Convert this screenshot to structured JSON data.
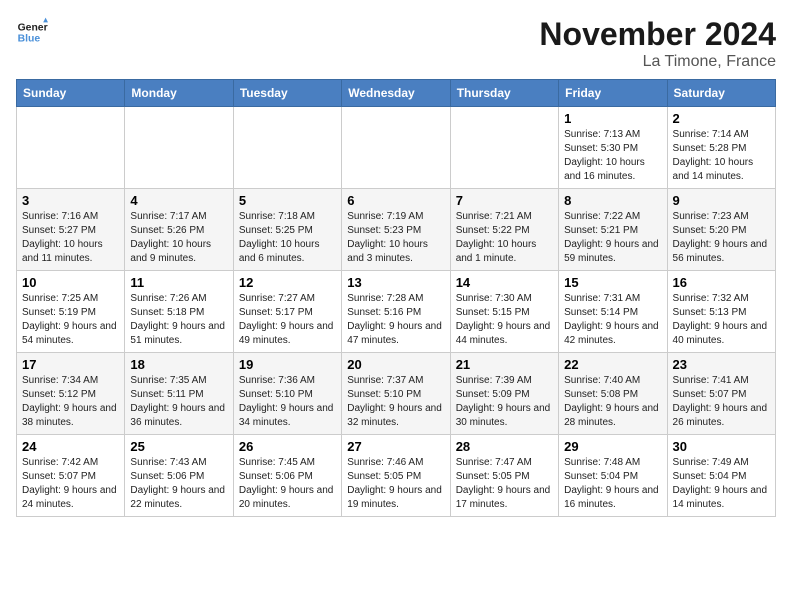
{
  "logo": {
    "line1": "General",
    "line2": "Blue"
  },
  "title": "November 2024",
  "location": "La Timone, France",
  "weekdays": [
    "Sunday",
    "Monday",
    "Tuesday",
    "Wednesday",
    "Thursday",
    "Friday",
    "Saturday"
  ],
  "weeks": [
    [
      {
        "day": "",
        "info": ""
      },
      {
        "day": "",
        "info": ""
      },
      {
        "day": "",
        "info": ""
      },
      {
        "day": "",
        "info": ""
      },
      {
        "day": "",
        "info": ""
      },
      {
        "day": "1",
        "info": "Sunrise: 7:13 AM\nSunset: 5:30 PM\nDaylight: 10 hours and 16 minutes."
      },
      {
        "day": "2",
        "info": "Sunrise: 7:14 AM\nSunset: 5:28 PM\nDaylight: 10 hours and 14 minutes."
      }
    ],
    [
      {
        "day": "3",
        "info": "Sunrise: 7:16 AM\nSunset: 5:27 PM\nDaylight: 10 hours and 11 minutes."
      },
      {
        "day": "4",
        "info": "Sunrise: 7:17 AM\nSunset: 5:26 PM\nDaylight: 10 hours and 9 minutes."
      },
      {
        "day": "5",
        "info": "Sunrise: 7:18 AM\nSunset: 5:25 PM\nDaylight: 10 hours and 6 minutes."
      },
      {
        "day": "6",
        "info": "Sunrise: 7:19 AM\nSunset: 5:23 PM\nDaylight: 10 hours and 3 minutes."
      },
      {
        "day": "7",
        "info": "Sunrise: 7:21 AM\nSunset: 5:22 PM\nDaylight: 10 hours and 1 minute."
      },
      {
        "day": "8",
        "info": "Sunrise: 7:22 AM\nSunset: 5:21 PM\nDaylight: 9 hours and 59 minutes."
      },
      {
        "day": "9",
        "info": "Sunrise: 7:23 AM\nSunset: 5:20 PM\nDaylight: 9 hours and 56 minutes."
      }
    ],
    [
      {
        "day": "10",
        "info": "Sunrise: 7:25 AM\nSunset: 5:19 PM\nDaylight: 9 hours and 54 minutes."
      },
      {
        "day": "11",
        "info": "Sunrise: 7:26 AM\nSunset: 5:18 PM\nDaylight: 9 hours and 51 minutes."
      },
      {
        "day": "12",
        "info": "Sunrise: 7:27 AM\nSunset: 5:17 PM\nDaylight: 9 hours and 49 minutes."
      },
      {
        "day": "13",
        "info": "Sunrise: 7:28 AM\nSunset: 5:16 PM\nDaylight: 9 hours and 47 minutes."
      },
      {
        "day": "14",
        "info": "Sunrise: 7:30 AM\nSunset: 5:15 PM\nDaylight: 9 hours and 44 minutes."
      },
      {
        "day": "15",
        "info": "Sunrise: 7:31 AM\nSunset: 5:14 PM\nDaylight: 9 hours and 42 minutes."
      },
      {
        "day": "16",
        "info": "Sunrise: 7:32 AM\nSunset: 5:13 PM\nDaylight: 9 hours and 40 minutes."
      }
    ],
    [
      {
        "day": "17",
        "info": "Sunrise: 7:34 AM\nSunset: 5:12 PM\nDaylight: 9 hours and 38 minutes."
      },
      {
        "day": "18",
        "info": "Sunrise: 7:35 AM\nSunset: 5:11 PM\nDaylight: 9 hours and 36 minutes."
      },
      {
        "day": "19",
        "info": "Sunrise: 7:36 AM\nSunset: 5:10 PM\nDaylight: 9 hours and 34 minutes."
      },
      {
        "day": "20",
        "info": "Sunrise: 7:37 AM\nSunset: 5:10 PM\nDaylight: 9 hours and 32 minutes."
      },
      {
        "day": "21",
        "info": "Sunrise: 7:39 AM\nSunset: 5:09 PM\nDaylight: 9 hours and 30 minutes."
      },
      {
        "day": "22",
        "info": "Sunrise: 7:40 AM\nSunset: 5:08 PM\nDaylight: 9 hours and 28 minutes."
      },
      {
        "day": "23",
        "info": "Sunrise: 7:41 AM\nSunset: 5:07 PM\nDaylight: 9 hours and 26 minutes."
      }
    ],
    [
      {
        "day": "24",
        "info": "Sunrise: 7:42 AM\nSunset: 5:07 PM\nDaylight: 9 hours and 24 minutes."
      },
      {
        "day": "25",
        "info": "Sunrise: 7:43 AM\nSunset: 5:06 PM\nDaylight: 9 hours and 22 minutes."
      },
      {
        "day": "26",
        "info": "Sunrise: 7:45 AM\nSunset: 5:06 PM\nDaylight: 9 hours and 20 minutes."
      },
      {
        "day": "27",
        "info": "Sunrise: 7:46 AM\nSunset: 5:05 PM\nDaylight: 9 hours and 19 minutes."
      },
      {
        "day": "28",
        "info": "Sunrise: 7:47 AM\nSunset: 5:05 PM\nDaylight: 9 hours and 17 minutes."
      },
      {
        "day": "29",
        "info": "Sunrise: 7:48 AM\nSunset: 5:04 PM\nDaylight: 9 hours and 16 minutes."
      },
      {
        "day": "30",
        "info": "Sunrise: 7:49 AM\nSunset: 5:04 PM\nDaylight: 9 hours and 14 minutes."
      }
    ]
  ]
}
